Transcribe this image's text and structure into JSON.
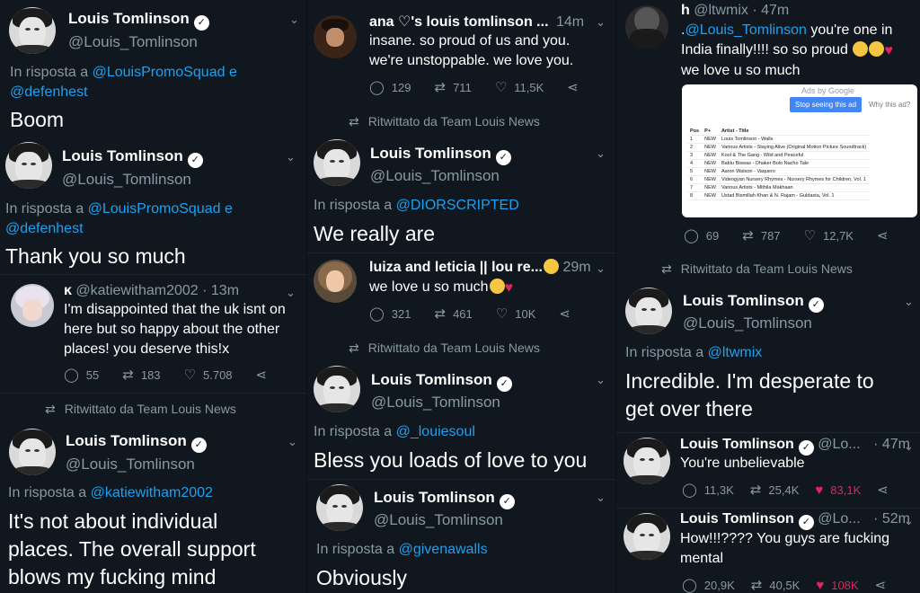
{
  "common": {
    "lt_name": "Louis Tomlinson",
    "lt_handle": "@Louis_Tomlinson",
    "in_reply_to": "In risposta a",
    "retweeted_by": "Ritwittato da Team Louis News"
  },
  "col1": {
    "t1": {
      "reply_user1": "@LouisPromoSquad e",
      "reply_user2": "@defenhest",
      "text": "Boom"
    },
    "t2": {
      "reply_user1": "@LouisPromoSquad e",
      "reply_user2": "@defenhest",
      "text": "Thank you so much"
    },
    "fan": {
      "name": "ĸ",
      "handle_time": "@katiewitham2002 · 13m",
      "text_l1": "I'm disappointed that the uk isnt on",
      "text_l2": "here but so happy about the other",
      "text_l3": "places! you deserve this!x",
      "replies": "55",
      "retweets": "183",
      "likes": "5.708"
    },
    "t3": {
      "reply_user": "@katiewitham2002",
      "text_l1": "It's not about individual",
      "text_l2": "places. The overall support",
      "text_l3": "blows my fucking mind"
    }
  },
  "col2": {
    "fan1": {
      "name": "ana ♡'s louis tomlinson ...",
      "time": "14m",
      "text_l1": "insane. so proud of us and you.",
      "text_l2": "we're unstoppable. we love you.",
      "replies": "129",
      "retweets": "711",
      "likes": "11,5K"
    },
    "t1": {
      "reply_user": "@DIORSCRIPTED",
      "text": "We really are"
    },
    "fan2": {
      "name": "luiza and leticia || lou re...",
      "time": "29m",
      "text": "we love u so much",
      "replies": "321",
      "retweets": "461",
      "likes": "10K"
    },
    "t2": {
      "reply_user": "@_louiesoul",
      "text": "Bless you loads of love to you"
    },
    "t3": {
      "reply_user": "@givenawalls",
      "text": "Obviously"
    }
  },
  "col3": {
    "fan": {
      "name": "h",
      "handle_time": "@ltwmix · 47m",
      "text_l1_pre": ".",
      "text_l1_link": "@Louis_Tomlinson",
      "text_l1_post": " you're one in",
      "text_l2": "India finally!!!! so so proud",
      "text_l3": "we love u so much",
      "replies": "69",
      "retweets": "787",
      "likes": "12,7K"
    },
    "ad": {
      "ads_by": "Ads by Google",
      "stop": "Stop seeing this ad",
      "why": "Why this ad?",
      "headers": [
        "Pos",
        "P+",
        "Artist - Title"
      ],
      "rows": [
        [
          "1",
          "NEW",
          "Louis Tomlinson - Walls"
        ],
        [
          "2",
          "NEW",
          "Various Artists - Staying Alive (Original Motion Picture Soundtrack)"
        ],
        [
          "3",
          "NEW",
          "Kool & The Gang - Wild and Peaceful"
        ],
        [
          "4",
          "NEW",
          "Bablu Biswas - Dhaker Bolo Nacho Tale"
        ],
        [
          "5",
          "NEW",
          "Aaron Watson - Vaquero"
        ],
        [
          "6",
          "NEW",
          "Videogyan Nursery Rhymes - Nursery Rhymes for Children, Vol. 1"
        ],
        [
          "7",
          "NEW",
          "Various Artists - Mithila Makhaan"
        ],
        [
          "8",
          "NEW",
          "Ustad Bismillah Khan & N. Rajam - Guldasta, Vol. 1"
        ]
      ]
    },
    "t1": {
      "reply_user": "@ltwmix",
      "text_l1": "Incredible. I'm desperate to",
      "text_l2": "get over there"
    },
    "t2": {
      "handle_trunc": "@Lo...",
      "time": "· 47m",
      "text": "You're unbelievable",
      "replies": "11,3K",
      "retweets": "25,4K",
      "likes": "83,1K"
    },
    "t3": {
      "handle_trunc": "@Lo...",
      "time": "· 52m",
      "text_l1": "How!!!???? You guys are fucking",
      "text_l2": "mental",
      "replies": "20,9K",
      "retweets": "40,5K",
      "likes": "108K"
    }
  },
  "icons": {
    "reply": "reply-icon",
    "retweet": "retweet-icon",
    "like": "heart-icon",
    "share": "share-icon",
    "verified": "verified-badge-icon",
    "chevron": "chevron-down-icon"
  },
  "colors": {
    "background": "#10171e",
    "link": "#1da1f2",
    "muted": "#8899a6",
    "like": "#e0245e"
  }
}
